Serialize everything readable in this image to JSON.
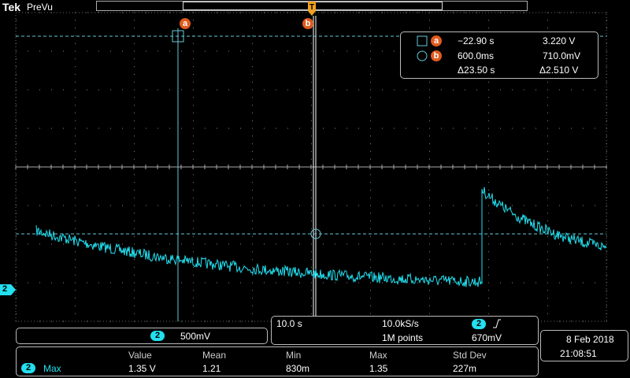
{
  "brand": "Tek",
  "mode": "PreVu",
  "trigger_marker_icon": "trigger-t-arrow-icon",
  "cursors": {
    "a": {
      "label": "a",
      "time": "−22.90 s",
      "voltage": "3.220 V"
    },
    "b": {
      "label": "b",
      "time": "600.0ms",
      "voltage": "710.0mV"
    },
    "delta_time": "Δ23.50 s",
    "delta_voltage": "Δ2.510 V"
  },
  "channel": {
    "number": "2",
    "scale": "500mV",
    "color": "#22e0f0"
  },
  "timebase": {
    "scale": "10.0 s",
    "sample_rate": "10.0kS/s",
    "record_length": "1M points",
    "trigger_channel": "2",
    "trigger_slope_icon": "rising-edge-icon",
    "trigger_level": "670mV"
  },
  "datetime": {
    "date": "8 Feb  2018",
    "time": "21:08:51"
  },
  "measurement": {
    "channel": "2",
    "type": "Max",
    "headers": [
      "Value",
      "Mean",
      "Min",
      "Max",
      "Std Dev"
    ],
    "values": [
      "1.35 V",
      "1.21",
      "830m",
      "1.35",
      "227m"
    ]
  },
  "colors": {
    "trace": "#22e0f0",
    "cursor_label": "#e05a1e",
    "trigger_marker": "#f0a020"
  }
}
